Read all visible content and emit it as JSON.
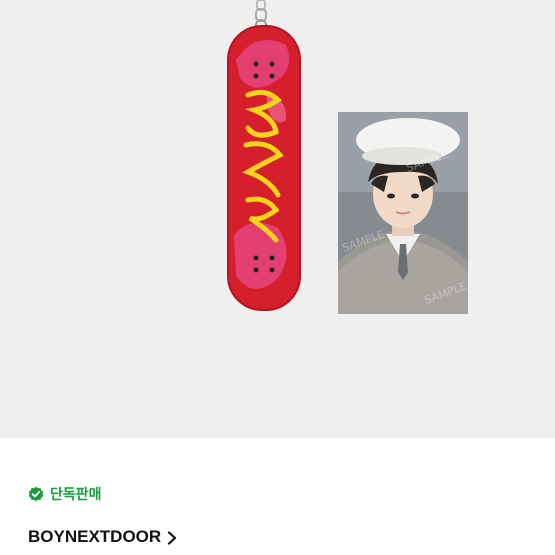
{
  "product_images": {
    "keyring": {
      "icon": "skateboard-keyring",
      "accent": "#d41e2b"
    },
    "photocard": {
      "icon": "photocard-image",
      "watermark": "SAMPLE"
    }
  },
  "badge": {
    "label": "단독판매",
    "icon": "verified-check-icon",
    "color": "#1a9b3e"
  },
  "brand": {
    "name": "BOYNEXTDOOR",
    "icon": "chevron-right-icon"
  }
}
